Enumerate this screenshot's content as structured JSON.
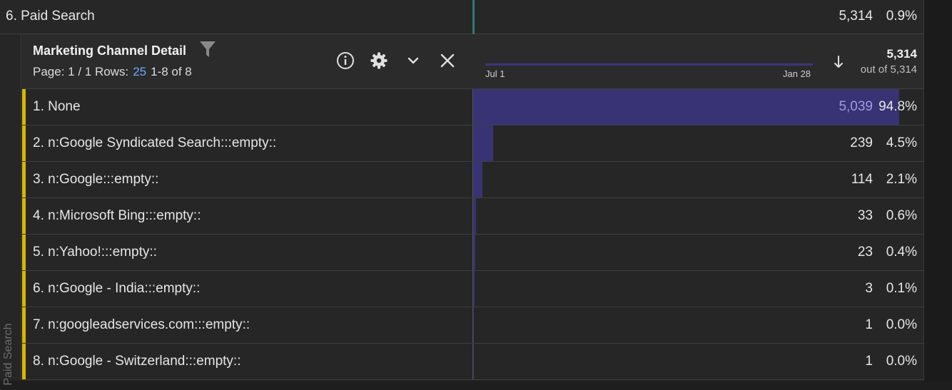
{
  "parent_row": {
    "label": "6.  Paid Search",
    "value": "5,314",
    "percent": "0.9%"
  },
  "side_label": "Paid Search",
  "breakdown": {
    "title": "Marketing Channel Detail",
    "page_label": "Page: 1 / 1  Rows:",
    "rows_value": "25",
    "range_text": "1-8 of 8",
    "sparkline_start": "Jul 1",
    "sparkline_end": "Jan 28",
    "total": "5,314",
    "total_of": "out of 5,314"
  },
  "icons": {
    "filter": "filter-icon",
    "info": "info-icon",
    "settings": "gear-icon",
    "expand": "chevron-down-icon",
    "close": "close-icon",
    "sort": "arrow-down-icon"
  },
  "colors": {
    "accent": "#d5b700",
    "bar": "#383374",
    "rows_link": "#6fa8ff",
    "parent_line": "#2f7a7a"
  },
  "rows": [
    {
      "label": "1.  None",
      "value": "5,039",
      "percent": "94.8%",
      "share": 0.948
    },
    {
      "label": "2.  n:Google Syndicated Search:::empty::",
      "value": "239",
      "percent": "4.5%",
      "share": 0.045
    },
    {
      "label": "3.  n:Google:::empty::",
      "value": "114",
      "percent": "2.1%",
      "share": 0.021
    },
    {
      "label": "4.  n:Microsoft Bing:::empty::",
      "value": "33",
      "percent": "0.6%",
      "share": 0.006
    },
    {
      "label": "5.  n:Yahoo!:::empty::",
      "value": "23",
      "percent": "0.4%",
      "share": 0.004
    },
    {
      "label": "6.  n:Google - India:::empty::",
      "value": "3",
      "percent": "0.1%",
      "share": 0.001
    },
    {
      "label": "7.  n:googleadservices.com:::empty::",
      "value": "1",
      "percent": "0.0%",
      "share": 0.0
    },
    {
      "label": "8.  n:Google - Switzerland:::empty::",
      "value": "1",
      "percent": "0.0%",
      "share": 0.0
    }
  ]
}
